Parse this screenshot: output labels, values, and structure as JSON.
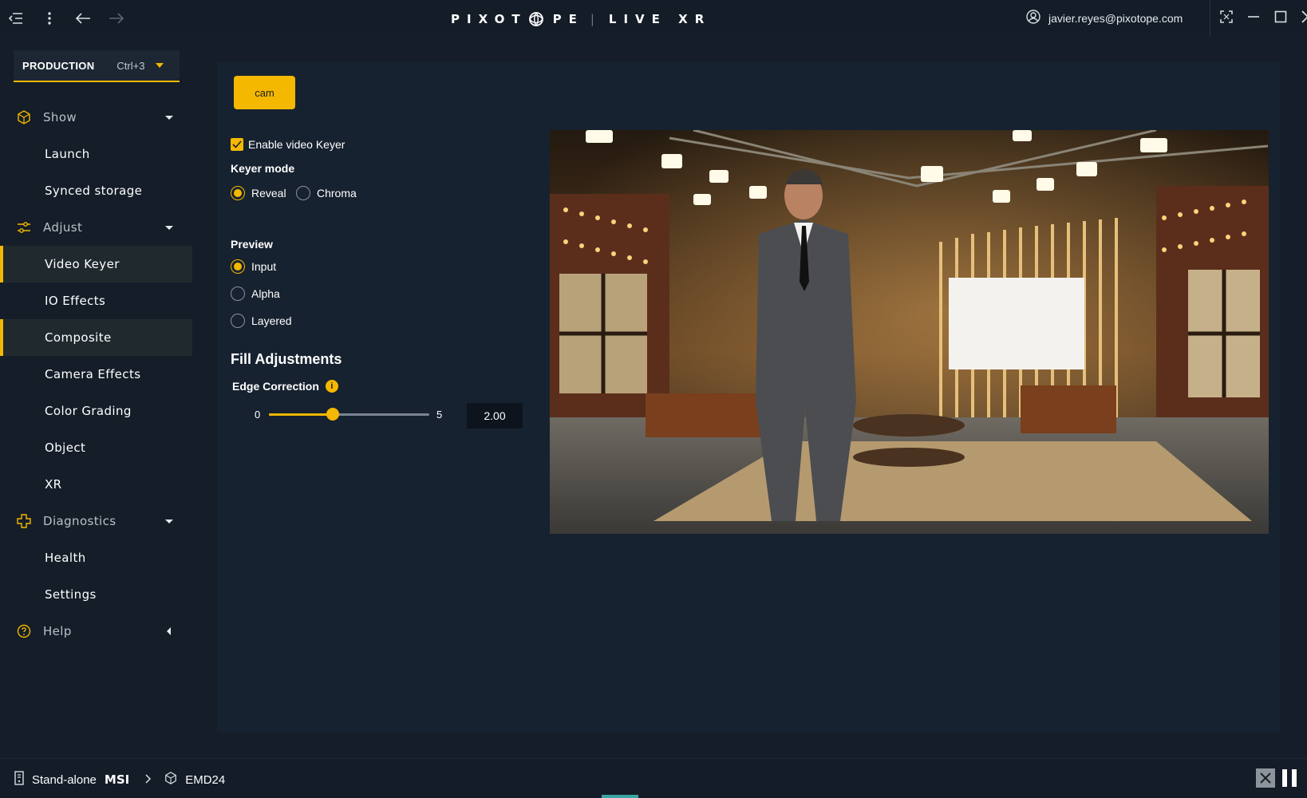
{
  "titlebar": {
    "brand_left": "PIXOT",
    "brand_right": "PE",
    "brand_product": "LIVE XR",
    "user_email": "javier.reyes@pixotope.com"
  },
  "sidebar": {
    "production": {
      "label": "PRODUCTION",
      "shortcut": "Ctrl+3"
    },
    "items": [
      {
        "label": "Show",
        "type": "section",
        "icon": "cube-icon"
      },
      {
        "label": "Launch",
        "type": "sub"
      },
      {
        "label": "Synced storage",
        "type": "sub"
      },
      {
        "label": "Adjust",
        "type": "section",
        "icon": "sliders-icon"
      },
      {
        "label": "Video Keyer",
        "type": "sub",
        "active": true
      },
      {
        "label": "IO Effects",
        "type": "sub"
      },
      {
        "label": "Composite",
        "type": "sub",
        "active": true
      },
      {
        "label": "Camera Effects",
        "type": "sub"
      },
      {
        "label": "Color Grading",
        "type": "sub"
      },
      {
        "label": "Object",
        "type": "sub"
      },
      {
        "label": "XR",
        "type": "sub"
      },
      {
        "label": "Diagnostics",
        "type": "section",
        "icon": "plus-icon"
      },
      {
        "label": "Health",
        "type": "sub"
      },
      {
        "label": "Settings",
        "type": "sub"
      },
      {
        "label": "Help",
        "type": "section",
        "icon": "question-circle-icon"
      }
    ]
  },
  "main": {
    "cam_button": "cam",
    "enable_video_keyer": {
      "label": "Enable video Keyer",
      "checked": true
    },
    "keyer_mode": {
      "label": "Keyer mode",
      "options": [
        "Reveal",
        "Chroma"
      ],
      "selected": "Reveal"
    },
    "preview": {
      "label": "Preview",
      "options": [
        "Input",
        "Alpha",
        "Layered"
      ],
      "selected": "Input"
    },
    "fill_adjustments": {
      "title": "Fill Adjustments",
      "edge_correction": {
        "label": "Edge Correction",
        "min": "0",
        "max": "5",
        "value": "2.00",
        "fraction": 0.4
      }
    }
  },
  "statusbar": {
    "mode": "Stand-alone",
    "machine": "MSI",
    "engine": "EMD24"
  },
  "colors": {
    "accent": "#f5b800",
    "background": "#141d28",
    "panel": "#172230"
  }
}
